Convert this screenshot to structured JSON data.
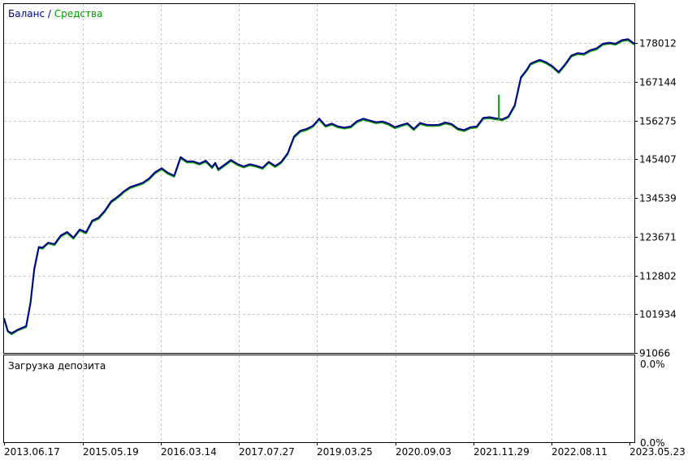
{
  "legend": {
    "balance": "Баланс",
    "separator": " / ",
    "equity": "Средства"
  },
  "colors": {
    "balance": "#00008b",
    "equity": "#00a000",
    "grid": "#c8c8c8",
    "axis": "#000000",
    "background": "#ffffff"
  },
  "chart_data": {
    "type": "line",
    "grid": true,
    "legend_position": "top-left",
    "y_ticks": [
      "91066",
      "101934",
      "112802",
      "123671",
      "134539",
      "145407",
      "156275",
      "167144",
      "178012"
    ],
    "ylim": [
      91066,
      185000
    ],
    "x_ticks": [
      "2013.06.17",
      "2015.05.19",
      "2016.03.14",
      "2017.07.27",
      "2019.03.25",
      "2020.09.03",
      "2021.11.29",
      "2022.08.11",
      "2023.05.23"
    ],
    "series": [
      {
        "name": "Баланс",
        "x": [
          0,
          0.006,
          0.012,
          0.022,
          0.035,
          0.042,
          0.048,
          0.055,
          0.061,
          0.07,
          0.08,
          0.09,
          0.1,
          0.11,
          0.12,
          0.13,
          0.14,
          0.15,
          0.16,
          0.17,
          0.175,
          0.185,
          0.19,
          0.2,
          0.21,
          0.22,
          0.23,
          0.24,
          0.25,
          0.26,
          0.27,
          0.28,
          0.29,
          0.3,
          0.31,
          0.32,
          0.33,
          0.335,
          0.34,
          0.36,
          0.37,
          0.38,
          0.39,
          0.4,
          0.41,
          0.42,
          0.43,
          0.44,
          0.45,
          0.46,
          0.47,
          0.48,
          0.49,
          0.5,
          0.51,
          0.52,
          0.53,
          0.54,
          0.55,
          0.56,
          0.57,
          0.58,
          0.59,
          0.6,
          0.61,
          0.62,
          0.63,
          0.64,
          0.65,
          0.66,
          0.67,
          0.68,
          0.69,
          0.7,
          0.71,
          0.72,
          0.73,
          0.74,
          0.75,
          0.76,
          0.77,
          0.78,
          0.785,
          0.79,
          0.8,
          0.81,
          0.82,
          0.83,
          0.835,
          0.84,
          0.85,
          0.86,
          0.87,
          0.88,
          0.89,
          0.9,
          0.91,
          0.92,
          0.923,
          0.93,
          0.94,
          0.95,
          0.96,
          0.97,
          0.98,
          0.99,
          1.0
        ],
        "values": [
          100800,
          97200,
          96600,
          97600,
          98600,
          105300,
          114700,
          120800,
          120600,
          122000,
          121600,
          124000,
          125000,
          123400,
          125700,
          124900,
          128200,
          129000,
          131000,
          133600,
          134200,
          135600,
          136400,
          137600,
          138200,
          138800,
          140000,
          141800,
          142900,
          141600,
          140800,
          146000,
          144800,
          144800,
          144200,
          145000,
          143200,
          144400,
          142600,
          145200,
          144100,
          143400,
          144000,
          143600,
          143000,
          144700,
          143500,
          144700,
          147100,
          151800,
          153400,
          153900,
          154800,
          156800,
          154800,
          155400,
          154600,
          154300,
          154600,
          156100,
          156800,
          156300,
          155800,
          156000,
          155400,
          154400,
          155000,
          155500,
          153900,
          155600,
          155100,
          155000,
          155100,
          155700,
          155300,
          154000,
          153600,
          154400,
          154600,
          157000,
          157200,
          156900,
          156800,
          156600,
          157400,
          160500,
          168400,
          170700,
          172200,
          172600,
          173300,
          172600,
          171500,
          169900,
          172000,
          174500,
          175200,
          175000,
          175300,
          176000,
          176500,
          177800,
          178100,
          177800,
          178800,
          179100,
          177800
        ]
      },
      {
        "name": "Средства",
        "x": [
          0,
          0.006,
          0.012,
          0.022,
          0.035,
          0.042,
          0.048,
          0.055,
          0.061,
          0.07,
          0.08,
          0.09,
          0.1,
          0.11,
          0.12,
          0.13,
          0.14,
          0.15,
          0.16,
          0.17,
          0.175,
          0.185,
          0.19,
          0.2,
          0.21,
          0.22,
          0.23,
          0.24,
          0.25,
          0.26,
          0.27,
          0.28,
          0.29,
          0.3,
          0.31,
          0.32,
          0.33,
          0.335,
          0.34,
          0.36,
          0.37,
          0.38,
          0.39,
          0.4,
          0.41,
          0.42,
          0.43,
          0.44,
          0.45,
          0.46,
          0.47,
          0.48,
          0.49,
          0.5,
          0.51,
          0.52,
          0.53,
          0.54,
          0.55,
          0.56,
          0.57,
          0.58,
          0.59,
          0.6,
          0.61,
          0.62,
          0.63,
          0.64,
          0.65,
          0.66,
          0.67,
          0.68,
          0.69,
          0.7,
          0.71,
          0.72,
          0.73,
          0.74,
          0.75,
          0.76,
          0.77,
          0.78,
          0.785,
          0.79,
          0.8,
          0.81,
          0.82,
          0.83,
          0.835,
          0.84,
          0.85,
          0.86,
          0.87,
          0.88,
          0.89,
          0.9,
          0.91,
          0.92,
          0.923,
          0.93,
          0.94,
          0.95,
          0.96,
          0.97,
          0.98,
          0.99,
          1.0
        ],
        "values": [
          100500,
          97000,
          96300,
          97400,
          98300,
          105000,
          114400,
          120500,
          120300,
          121800,
          121300,
          123700,
          124700,
          123100,
          125400,
          124600,
          127900,
          128700,
          130700,
          133300,
          133900,
          135300,
          136100,
          137300,
          137900,
          138500,
          139700,
          141500,
          142600,
          141300,
          140500,
          145700,
          144500,
          144500,
          143900,
          144700,
          142900,
          144100,
          142300,
          144900,
          143800,
          143100,
          143700,
          143300,
          142700,
          144400,
          143200,
          144400,
          146800,
          151500,
          153100,
          153600,
          154500,
          156500,
          154500,
          155100,
          154300,
          154000,
          154300,
          155800,
          156500,
          156000,
          155500,
          155700,
          155100,
          154100,
          154700,
          155200,
          153600,
          155300,
          154800,
          154700,
          154800,
          155400,
          155000,
          153700,
          153300,
          154100,
          154300,
          156700,
          156900,
          156600,
          156500,
          156300,
          157100,
          160200,
          168100,
          170400,
          171900,
          172300,
          173000,
          172300,
          171200,
          169600,
          171700,
          174200,
          174900,
          174700,
          175000,
          175700,
          176200,
          177500,
          177800,
          177500,
          178500,
          178800,
          177500
        ]
      }
    ],
    "equity_spike": {
      "x": 0.785,
      "value": 163500
    }
  },
  "deposit_panel": {
    "title": "Загрузка депозита",
    "top_value": "0.0%",
    "bottom_value": "0.0%"
  }
}
